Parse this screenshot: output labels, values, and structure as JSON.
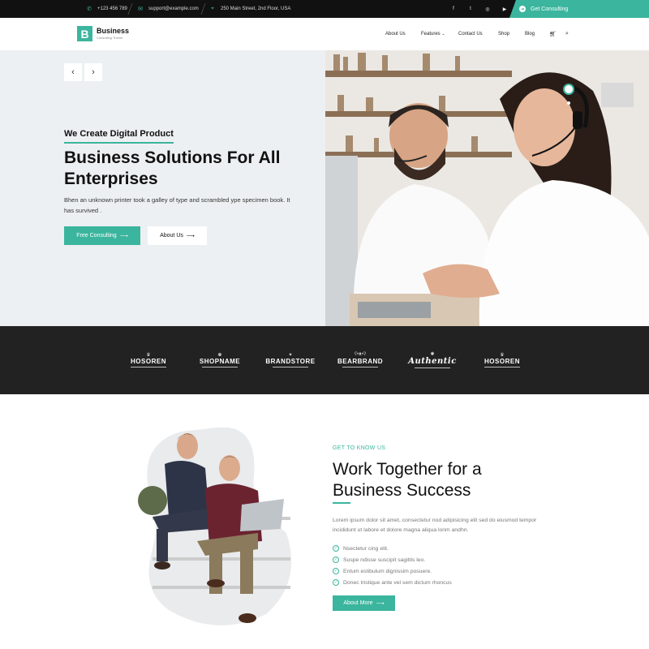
{
  "topbar": {
    "phone": "+123 456 789",
    "email": "support@example.com",
    "address": "250 Main Street, 2nd Floor, USA",
    "social": [
      "f",
      "t",
      "◎",
      "▶"
    ],
    "cta": "Get Consulting"
  },
  "nav": {
    "logo_letter": "B",
    "logo_name": "Business",
    "logo_tagline": "Consulting Theme",
    "items": [
      "About Us",
      "Features",
      "Contact Us",
      "Shop",
      "Blog"
    ]
  },
  "hero": {
    "eyebrow": "We Create Digital Product",
    "title": "Business Solutions For All Enterprises",
    "text": "Bhen an unknown printer took a galley of type and scrambled ype specimen book. It has survived .",
    "primary_btn": "Free Consulting",
    "secondary_btn": "About Us"
  },
  "brands": [
    "HOSOREN",
    "SHOPNAME",
    "BRANDSTORE",
    "BEARBRAND",
    "Authentic",
    "HOSOREN"
  ],
  "about": {
    "eyebrow": "GET TO KNOW US",
    "title": "Work Together for a Business Success",
    "text": "Lorem ipsum dolor sit amet, consectetur nod adipisicing elit sed do eiusmod tempor incididunt ut labore et dolore magna aliqua lonm andhn.",
    "checks": [
      "Nsectetur cing elit.",
      "Suspe ndisse suscipit sagittis leo.",
      "Entum estibulum dignissim posuere.",
      "Donec tristique ante vel sem dictum rhoncus"
    ],
    "button": "About More"
  },
  "colors": {
    "accent": "#3bb59e",
    "dark": "#111111",
    "strip": "#222222"
  }
}
